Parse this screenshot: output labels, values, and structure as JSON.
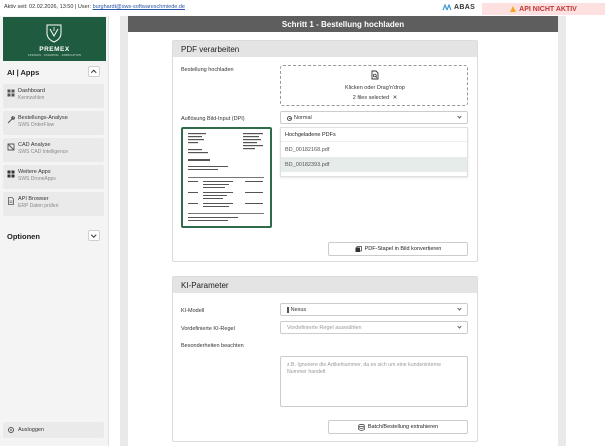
{
  "topbar": {
    "active_since": "Aktiv seit: 02.02.2026, 13:50 | User: ",
    "user_email": "burghardt@sws-softwareschmiede.de",
    "abas_label": "ABAS",
    "api_status": "API NICHT AKTIV"
  },
  "sidebar": {
    "brand": "PREMEX",
    "brand_sub": "SPRINGS · STAMPING · FABRICATION",
    "apps_title": "AI | Apps",
    "items": [
      {
        "title": "Dashboard",
        "subtitle": "Kennzahlen"
      },
      {
        "title": "Bestellungs-Analyse",
        "subtitle": "SWS OrderFlow"
      },
      {
        "title": "CAD Analyse",
        "subtitle": "SWS CAD Intelligence"
      },
      {
        "title": "Weitere Apps",
        "subtitle": "SWS DroneApps"
      },
      {
        "title": "API Browser",
        "subtitle": "ERP Daten prüfen"
      }
    ],
    "options_title": "Optionen",
    "logout_label": "Ausloggen"
  },
  "main": {
    "header": "Schritt 1 - Bestellung hochladen",
    "pdf_panel": {
      "title": "PDF verarbeiten",
      "upload_label": "Bestellung hochladen",
      "drop_text": "Klicken oder Drag'n'drop",
      "files_selected": "2 files selected",
      "dpi_label": "Auflösung Bild-Input (DPI)",
      "dpi_value": "Normal",
      "files_header": "Hochgeladene PDFs",
      "files": [
        "BD_00182168.pdf",
        "BD_00182393.pdf"
      ],
      "convert_button": "PDF-Stapel in Bild konvertieren"
    },
    "ki_panel": {
      "title": "KI-Parameter",
      "model_label": "KI-Modell",
      "model_value": "Nexus",
      "rule_label": "Vordefinierte KI-Regel",
      "rule_placeholder": "Vordefinierte Regel auswählen",
      "notes_label": "Besonderheiten beachten",
      "notes_placeholder": "z.B. Ignoriere die Artikelnummer, da es sich um eine kundeninterne Nummer handelt",
      "extract_button": "Batch/Bestellung extrahieren"
    }
  },
  "colors": {
    "brand_green": "#1f5b3e",
    "alert_red": "#c23535",
    "alert_bg": "#fde0e0",
    "header_gray": "#5e5e5e"
  }
}
